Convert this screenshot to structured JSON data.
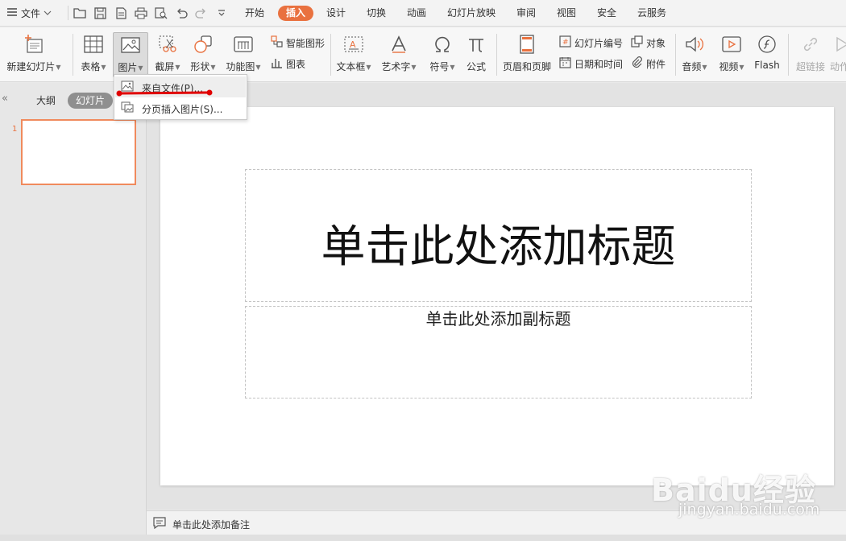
{
  "menubar": {
    "file_label": "文件",
    "tabs": [
      {
        "label": "开始"
      },
      {
        "label": "插入"
      },
      {
        "label": "设计"
      },
      {
        "label": "切换"
      },
      {
        "label": "动画"
      },
      {
        "label": "幻灯片放映"
      },
      {
        "label": "审阅"
      },
      {
        "label": "视图"
      },
      {
        "label": "安全"
      },
      {
        "label": "云服务"
      }
    ],
    "active_tab": "插入"
  },
  "ribbon": {
    "new_slide": "新建幻灯片",
    "table": "表格",
    "picture": "图片",
    "screenshot": "截屏",
    "shape": "形状",
    "function_chart": "功能图",
    "smartart": "智能图形",
    "chart": "图表",
    "textbox": "文本框",
    "wordart": "艺术字",
    "symbol": "符号",
    "formula": "公式",
    "header_footer": "页眉和页脚",
    "slide_number": "幻灯片编号",
    "date_time": "日期和时间",
    "object": "对象",
    "attachment": "附件",
    "audio": "音频",
    "video": "视频",
    "flash": "Flash",
    "hyperlink": "超链接",
    "action": "动作"
  },
  "dropdown": {
    "items": [
      {
        "label": "来自文件(P)..."
      },
      {
        "label": "分页插入图片(S)..."
      }
    ]
  },
  "left_panel": {
    "tab_outline": "大纲",
    "tab_slides": "幻灯片",
    "slide_number": "1"
  },
  "slide": {
    "title_placeholder": "单击此处添加标题",
    "subtitle_placeholder": "单击此处添加副标题"
  },
  "notes": {
    "placeholder": "单击此处添加备注"
  },
  "colors": {
    "accent": "#e9713f",
    "annotation": "#e00000"
  },
  "watermark": {
    "logo": "Baidu经验",
    "url": "jingyan.baidu.com"
  }
}
